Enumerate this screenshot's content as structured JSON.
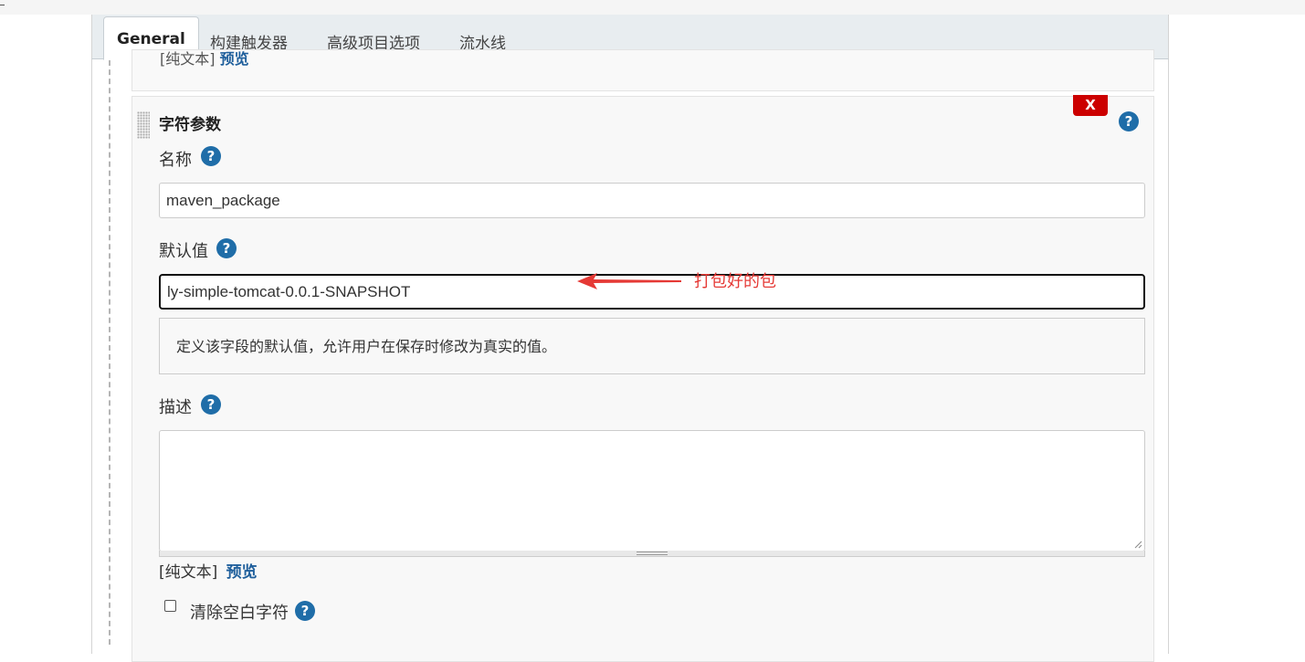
{
  "tabs": [
    {
      "label": "General",
      "active": true
    },
    {
      "label": "构建触发器"
    },
    {
      "label": "高级项目选项"
    },
    {
      "label": "流水线"
    }
  ],
  "param": {
    "title": "字符参数",
    "delete_label": "X",
    "name_label": "名称",
    "name_value": "maven_package",
    "default_label": "默认值",
    "default_value": "ly-simple-tomcat-0.0.1-SNAPSHOT",
    "default_help": "定义该字段的默认值，允许用户在保存时修改为真实的值。",
    "description_label": "描述",
    "description_value": "",
    "format_plain": "[纯文本]",
    "format_preview": "预览",
    "trim_label": "清除空白字符"
  },
  "annotation": {
    "text": "打包好的包",
    "color": "#e53935"
  },
  "help_glyph": "?",
  "colors": {
    "accent": "#1f6da8",
    "delete": "#cc0000",
    "link": "#1f5f9c"
  }
}
